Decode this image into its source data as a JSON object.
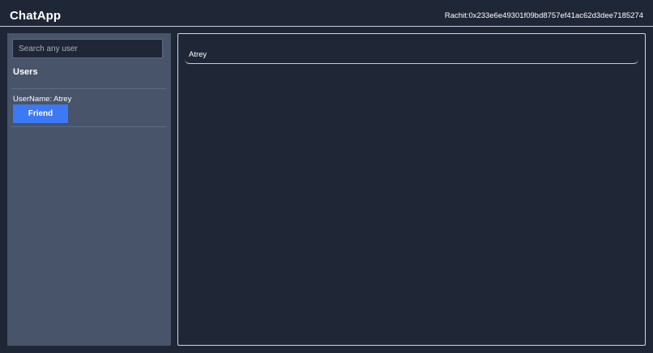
{
  "header": {
    "app_title": "ChatApp",
    "account": "Rachit:0x233e6e49301f09bd8757ef41ac62d3dee7185274"
  },
  "sidebar": {
    "search_placeholder": "Search any user",
    "search_value": "",
    "section_title": "Users",
    "users": [
      {
        "label": "UserName: Atrey",
        "button_label": "Friend"
      }
    ]
  },
  "chat": {
    "selected_user": "Atrey"
  },
  "colors": {
    "background": "#1f2737",
    "sidebar": "#475469",
    "accent_button": "#3b79f5"
  }
}
